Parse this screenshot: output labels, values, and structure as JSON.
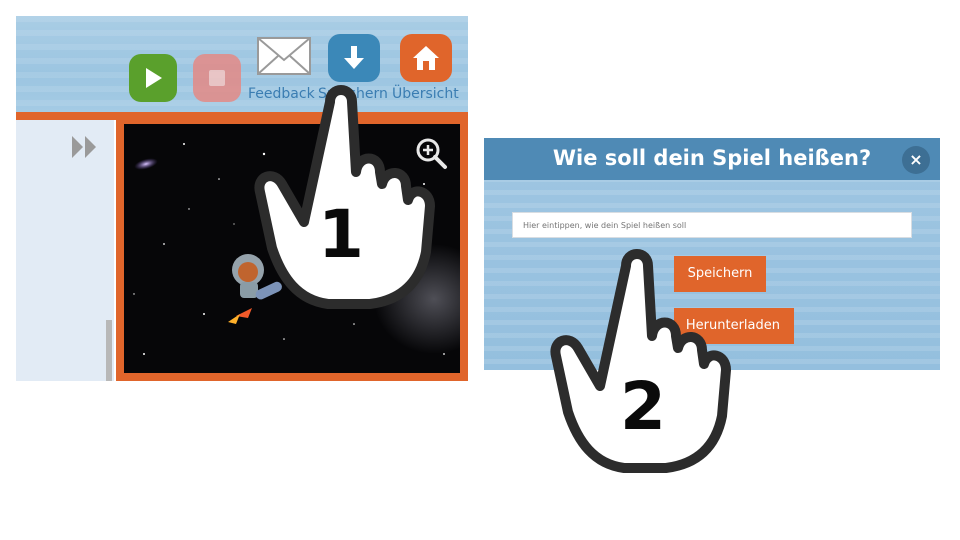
{
  "panel1": {
    "toolbar": {
      "start_icon": "play-icon",
      "stop_icon": "stop-icon",
      "feedback_label": "Feedback",
      "feedback_icon": "envelope-icon",
      "save_label": "Speichern",
      "save_icon": "download-arrow-icon",
      "overview_label": "Übersicht",
      "overview_icon": "home-icon"
    },
    "sidebar_toggle_icon": "double-chevron-right-icon",
    "stage": {
      "zoom_icon": "zoom-in-icon",
      "sprite": "astronaut-on-rocket"
    },
    "step_number": "1"
  },
  "panel2": {
    "dialog_title": "Wie soll dein Spiel heißen?",
    "close_label": "×",
    "name_input": {
      "placeholder": "Hier eintippen, wie dein Spiel heißen soll"
    },
    "save_button_label": "Speichern",
    "download_button_label": "Herunterladen",
    "step_number": "2"
  },
  "colors": {
    "accent_orange": "#e0652b",
    "start_green": "#5aa02c",
    "save_blue": "#3b88b8",
    "header_blue": "#4f8ab5"
  }
}
